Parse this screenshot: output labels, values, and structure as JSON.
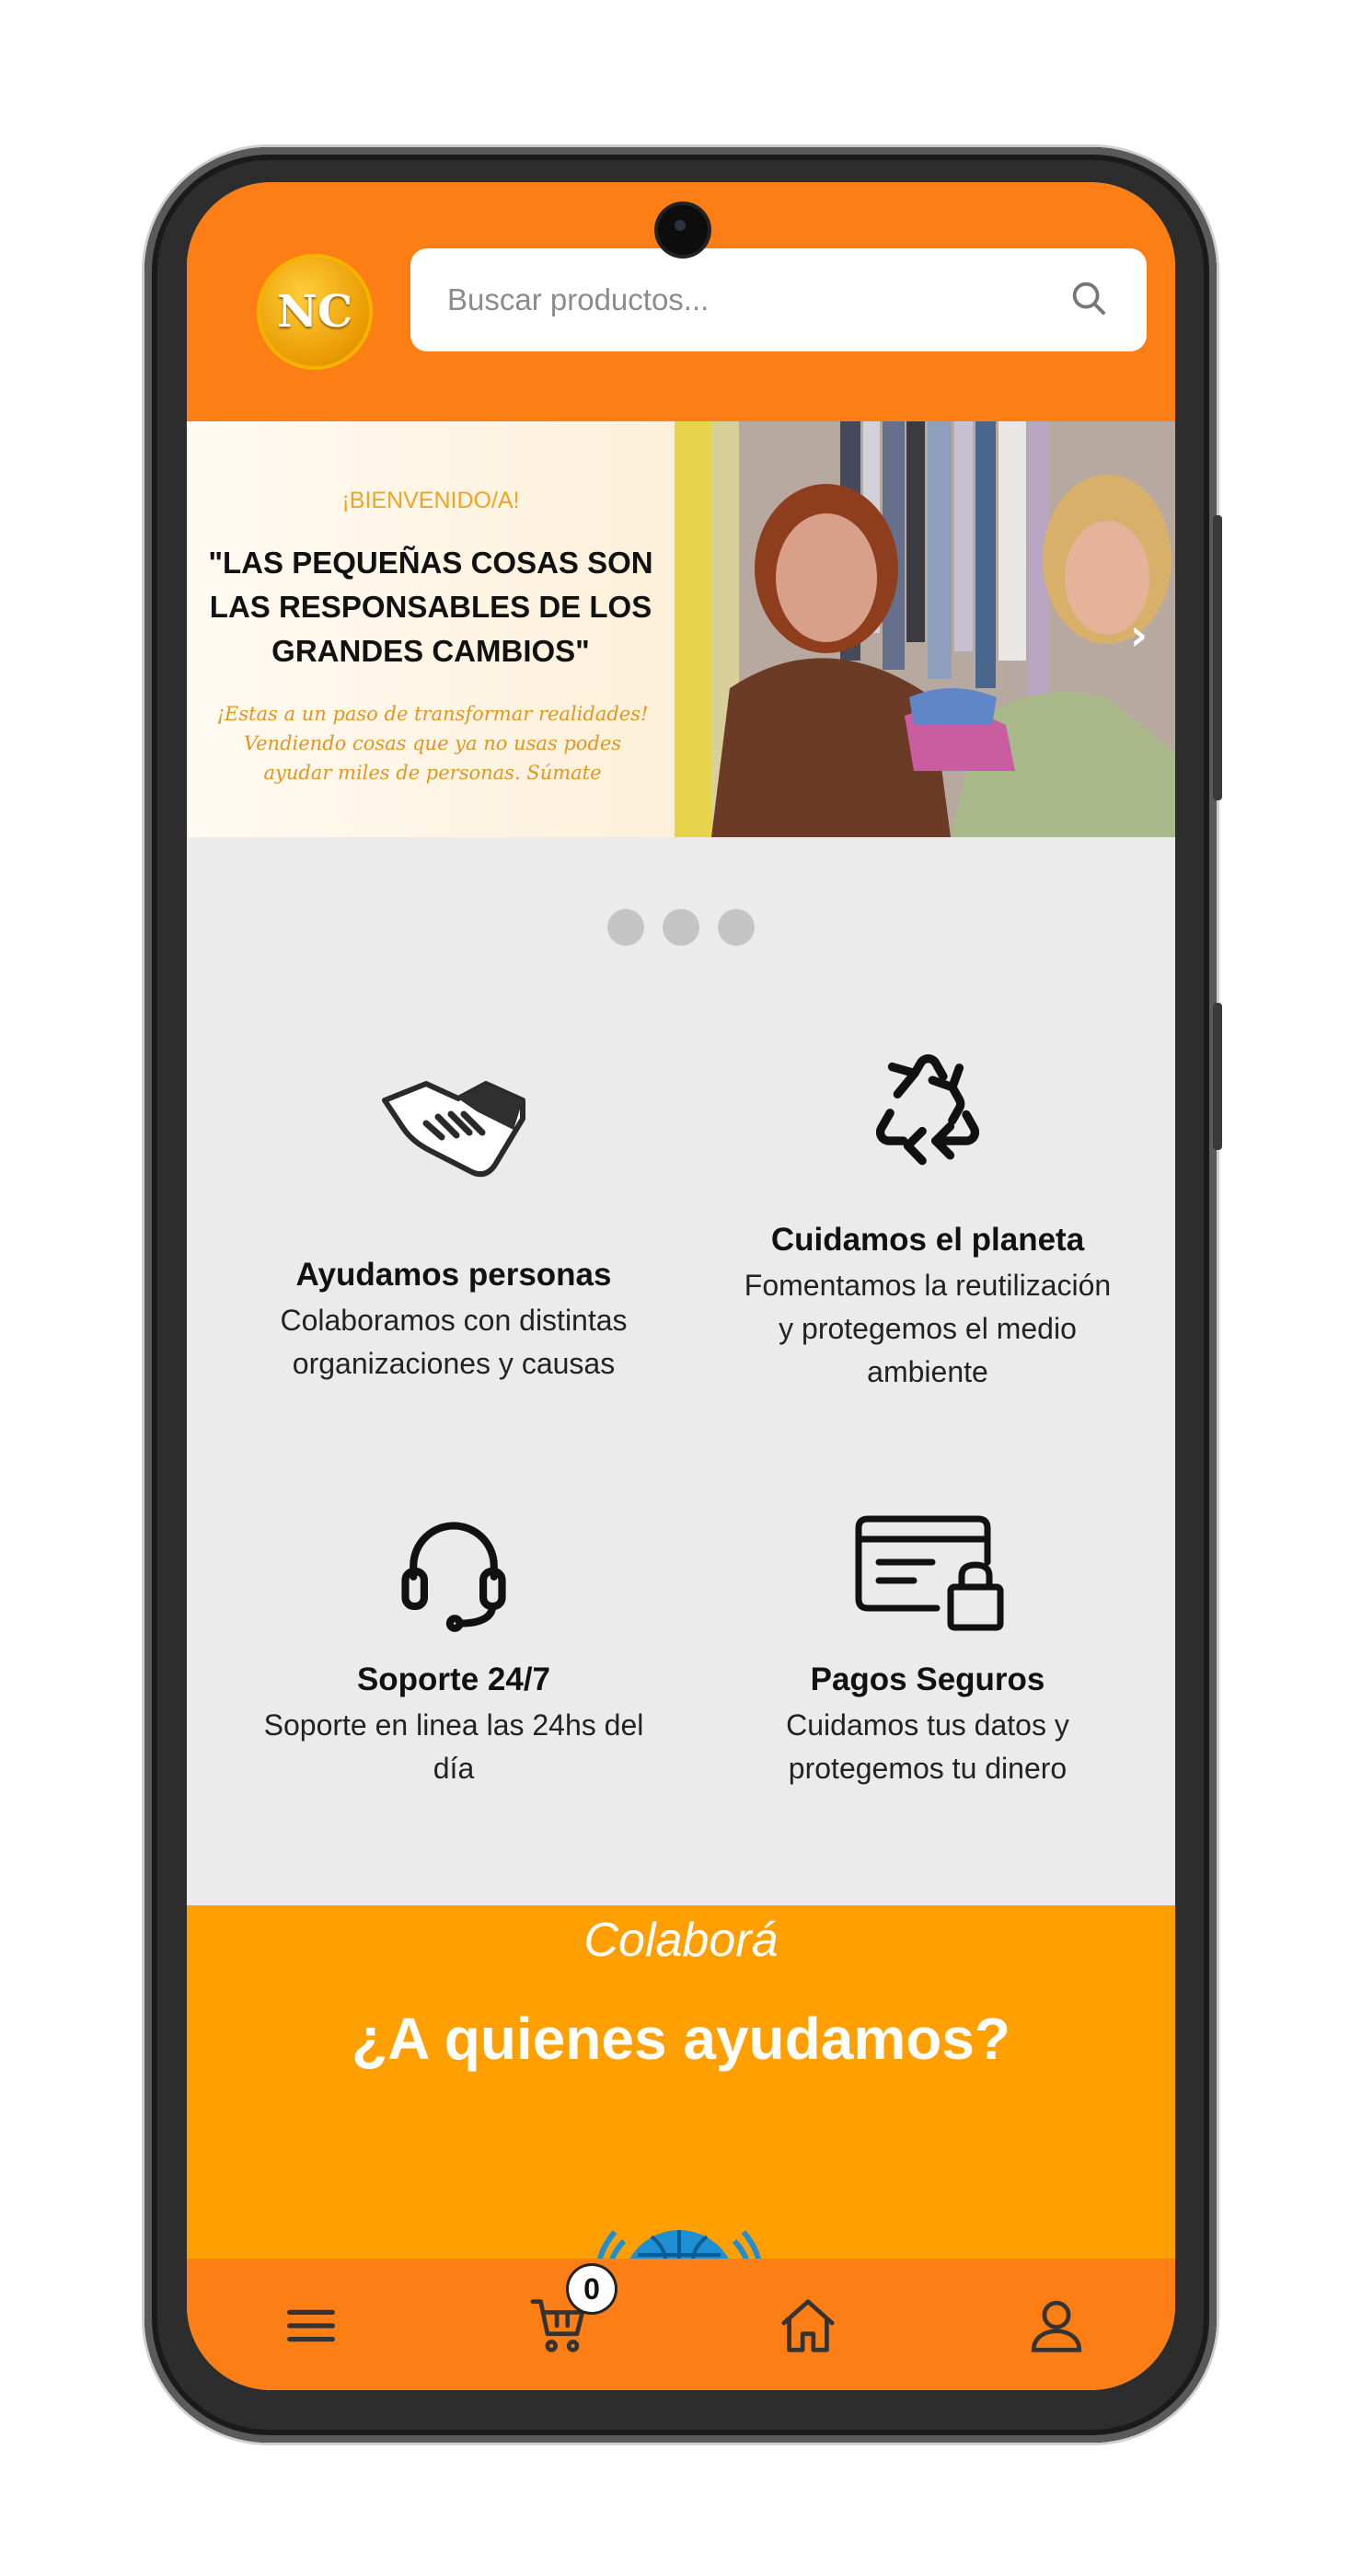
{
  "header": {
    "logo_text": "NC",
    "search_placeholder": "Buscar productos..."
  },
  "banner": {
    "kicker": "¡BIENVENIDO/A!",
    "quote": "\"LAS PEQUEÑAS COSAS SON LAS RESPONSABLES DE LOS GRANDES CAMBIOS\"",
    "subtitle": "¡Estas a un paso de transformar realidades! Vendiendo cosas que ya no usas podes ayudar miles de personas. Súmate",
    "next_glyph": "›",
    "slide_count": 3
  },
  "features": [
    {
      "icon": "handshake-icon",
      "title": "Ayudamos personas",
      "desc": "Colaboramos con distintas organizaciones y causas"
    },
    {
      "icon": "recycle-icon",
      "title": "Cuidamos el planeta",
      "desc": "Fomentamos la reutilización y protegemos el medio ambiente"
    },
    {
      "icon": "headset-icon",
      "title": "Soporte 24/7",
      "desc": "Soporte en linea las 24hs del día"
    },
    {
      "icon": "secure-card-icon",
      "title": "Pagos Seguros",
      "desc": "Cuidamos tus datos y protegemos tu dinero"
    }
  ],
  "collab": {
    "kicker": "Colaborá",
    "title": "¿A quienes ayudamos?"
  },
  "bottom_nav": {
    "items": [
      "menu-icon",
      "cart-icon",
      "home-icon",
      "user-icon"
    ],
    "cart_count": "0"
  },
  "colors": {
    "primary_orange": "#fd7e14",
    "section_orange": "#ff9f00",
    "background_gray": "#ebebeb"
  }
}
